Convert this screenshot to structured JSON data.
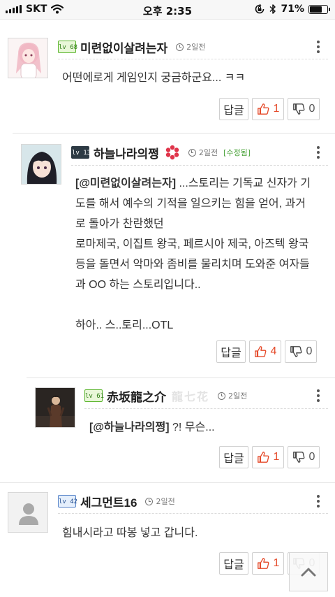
{
  "status_bar": {
    "carrier": "SKT",
    "time": "오후 2:35",
    "battery": "71%",
    "battery_level": 0.71
  },
  "comments": [
    {
      "level": "lv 68",
      "level_style": "green",
      "nickname": "미련없이살려는자",
      "time": "2일전",
      "text": "어떤에로게 게임인지 궁금하군요... ㅋㅋ",
      "reply_label": "답글",
      "likes": "1",
      "dislikes": "0"
    },
    {
      "level": "lv 136",
      "level_style": "dark",
      "nickname": "하늘나라의쩡",
      "time": "2일전",
      "edited": "[수정됨]",
      "mention": "[@미련없이살려는자]",
      "text_lines": [
        " ...스토리는 기독교 신자가 기",
        "도를 해서 예수의 기적을 일으키는 힘을 얻어, 과거",
        "로 돌아가 찬란했던",
        "로마제국, 이집트 왕국, 페르시아 제국, 아즈텍 왕국",
        "등을 돌면서 악마와 좀비를 물리치며 도와준 여자들",
        "과 OO 하는 스토리입니다..",
        "",
        "하아.. 스..토리...OTL"
      ],
      "reply_label": "답글",
      "likes": "4",
      "dislikes": "0"
    },
    {
      "level": "lv 61",
      "level_style": "green",
      "nickname": "赤坂龍之介",
      "seal": "龍七花",
      "time": "2일전",
      "mention": "[@하늘나라의쩡]",
      "text": " ?! 무슨...",
      "reply_label": "답글",
      "likes": "1",
      "dislikes": "0"
    },
    {
      "level": "lv 42",
      "level_style": "blue",
      "nickname": "세그먼트16",
      "time": "2일전",
      "text": "힘내시라고 따봉 넣고 갑니다.",
      "reply_label": "답글",
      "likes": "1",
      "dislikes": "0"
    }
  ],
  "icons": {
    "like": "thumbs-up-icon",
    "dislike": "thumbs-down-icon",
    "more": "more-vertical-icon",
    "time": "clock-icon",
    "scroll_top": "chevron-up-icon"
  },
  "colors": {
    "like_count": "#e54b2b",
    "edited": "#4aa33a",
    "level_green": "#5ab52c",
    "level_dark": "#2d3a44",
    "level_blue": "#5784c9"
  }
}
